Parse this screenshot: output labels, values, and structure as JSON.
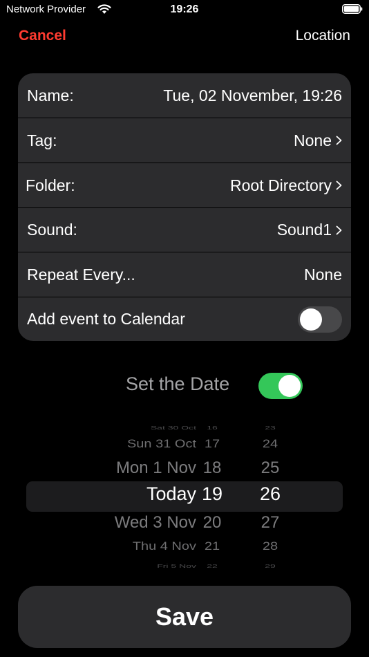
{
  "status_bar": {
    "carrier": "Network Provider",
    "time": "19:26",
    "wifi_icon": "wifi-icon",
    "battery_icon": "battery-icon"
  },
  "nav": {
    "cancel_label": "Cancel",
    "location_label": "Location",
    "cancel_color": "#ff3b30"
  },
  "form": {
    "name_label": "Name:",
    "name_value": "Tue, 02 November, 19:26",
    "tag_label": "Tag:",
    "tag_value": "None",
    "folder_label": "Folder:",
    "folder_value": "Root Directory",
    "sound_label": "Sound:",
    "sound_value": "Sound1",
    "repeat_label": "Repeat Every...",
    "repeat_value": "None",
    "calendar_label": "Add event to Calendar",
    "calendar_enabled": false
  },
  "date_section": {
    "label": "Set the Date",
    "enabled": true,
    "toggle_color": "#34c759"
  },
  "picker": {
    "rows": [
      {
        "day": "Sat 30 Oct",
        "hour": "16",
        "minute": "23"
      },
      {
        "day": "Sun 31 Oct",
        "hour": "17",
        "minute": "24"
      },
      {
        "day": "Mon 1 Nov",
        "hour": "18",
        "minute": "25"
      },
      {
        "day": "Today",
        "hour": "19",
        "minute": "26"
      },
      {
        "day": "Wed 3 Nov",
        "hour": "20",
        "minute": "27"
      },
      {
        "day": "Thu 4 Nov",
        "hour": "21",
        "minute": "28"
      },
      {
        "day": "Fri 5 Nov",
        "hour": "22",
        "minute": "29"
      }
    ],
    "selected_index": 3
  },
  "save_label": "Save"
}
